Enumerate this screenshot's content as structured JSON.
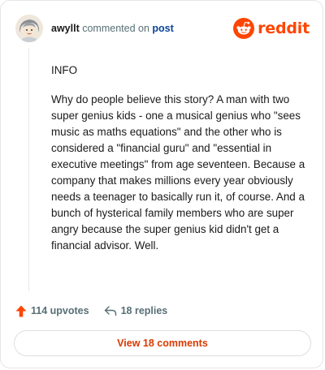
{
  "header": {
    "username": "awyllt",
    "commented_on": "commented on",
    "post_link": "post",
    "brand": "reddit"
  },
  "comment": {
    "paragraphs": [
      "INFO",
      "Why do people believe this story? A man with two super genius kids - one a musical genius who \"sees music as maths equations\" and the other who is considered a \"financial guru\" and \"essential in executive meetings\" from age seventeen. Because a company that makes millions every year obviously needs a teenager to basically run it, of course. And a bunch of hysterical family members who are super angry because the super genius kid didn't get a financial advisor. Well."
    ]
  },
  "actions": {
    "upvotes": "114 upvotes",
    "replies": "18 replies"
  },
  "view_comments": "View 18 comments",
  "colors": {
    "brand": "#ff4500",
    "link": "#0a449b",
    "button_text": "#d93a00"
  },
  "icons": {
    "avatar": "avatar-icon",
    "brand": "reddit-logo-icon",
    "upvote": "upvote-arrow-icon",
    "reply": "reply-arrow-icon"
  }
}
